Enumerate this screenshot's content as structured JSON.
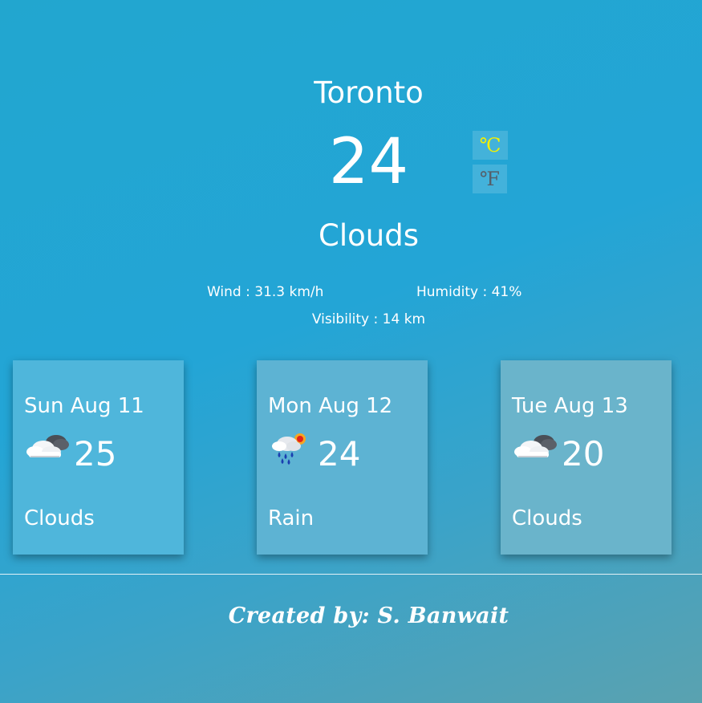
{
  "current": {
    "city": "Toronto",
    "temperature": "24",
    "unit_celsius": "℃",
    "unit_fahrenheit": "℉",
    "active_unit": "celsius",
    "condition": "Clouds",
    "wind": "Wind : 31.3 km/h",
    "humidity": "Humidity : 41%",
    "visibility": "Visibility : 14 km"
  },
  "forecast": [
    {
      "date": "Sun Aug 11",
      "icon": "cloudy-icon",
      "temp": "25",
      "condition": "Clouds"
    },
    {
      "date": "Mon Aug 12",
      "icon": "rain-sun-icon",
      "temp": "24",
      "condition": "Rain"
    },
    {
      "date": "Tue Aug 13",
      "icon": "cloudy-icon",
      "temp": "20",
      "condition": "Clouds"
    }
  ],
  "footer": {
    "credit": "Created by: S. Banwait"
  },
  "colors": {
    "active_unit": "#f4f000",
    "inactive_unit": "#555f6a"
  }
}
